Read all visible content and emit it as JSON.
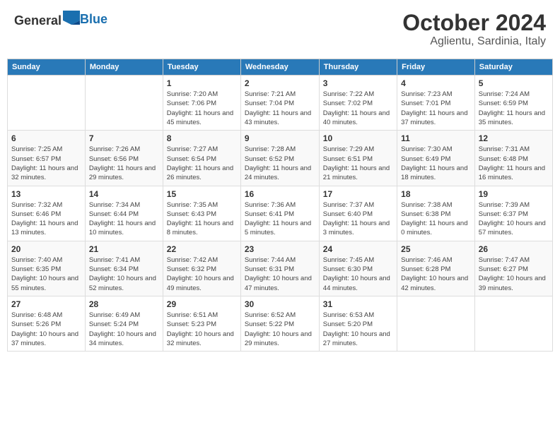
{
  "header": {
    "logo_general": "General",
    "logo_blue": "Blue",
    "month": "October 2024",
    "location": "Aglientu, Sardinia, Italy"
  },
  "weekdays": [
    "Sunday",
    "Monday",
    "Tuesday",
    "Wednesday",
    "Thursday",
    "Friday",
    "Saturday"
  ],
  "weeks": [
    [
      {
        "day": "",
        "info": ""
      },
      {
        "day": "",
        "info": ""
      },
      {
        "day": "1",
        "info": "Sunrise: 7:20 AM\nSunset: 7:06 PM\nDaylight: 11 hours and 45 minutes."
      },
      {
        "day": "2",
        "info": "Sunrise: 7:21 AM\nSunset: 7:04 PM\nDaylight: 11 hours and 43 minutes."
      },
      {
        "day": "3",
        "info": "Sunrise: 7:22 AM\nSunset: 7:02 PM\nDaylight: 11 hours and 40 minutes."
      },
      {
        "day": "4",
        "info": "Sunrise: 7:23 AM\nSunset: 7:01 PM\nDaylight: 11 hours and 37 minutes."
      },
      {
        "day": "5",
        "info": "Sunrise: 7:24 AM\nSunset: 6:59 PM\nDaylight: 11 hours and 35 minutes."
      }
    ],
    [
      {
        "day": "6",
        "info": "Sunrise: 7:25 AM\nSunset: 6:57 PM\nDaylight: 11 hours and 32 minutes."
      },
      {
        "day": "7",
        "info": "Sunrise: 7:26 AM\nSunset: 6:56 PM\nDaylight: 11 hours and 29 minutes."
      },
      {
        "day": "8",
        "info": "Sunrise: 7:27 AM\nSunset: 6:54 PM\nDaylight: 11 hours and 26 minutes."
      },
      {
        "day": "9",
        "info": "Sunrise: 7:28 AM\nSunset: 6:52 PM\nDaylight: 11 hours and 24 minutes."
      },
      {
        "day": "10",
        "info": "Sunrise: 7:29 AM\nSunset: 6:51 PM\nDaylight: 11 hours and 21 minutes."
      },
      {
        "day": "11",
        "info": "Sunrise: 7:30 AM\nSunset: 6:49 PM\nDaylight: 11 hours and 18 minutes."
      },
      {
        "day": "12",
        "info": "Sunrise: 7:31 AM\nSunset: 6:48 PM\nDaylight: 11 hours and 16 minutes."
      }
    ],
    [
      {
        "day": "13",
        "info": "Sunrise: 7:32 AM\nSunset: 6:46 PM\nDaylight: 11 hours and 13 minutes."
      },
      {
        "day": "14",
        "info": "Sunrise: 7:34 AM\nSunset: 6:44 PM\nDaylight: 11 hours and 10 minutes."
      },
      {
        "day": "15",
        "info": "Sunrise: 7:35 AM\nSunset: 6:43 PM\nDaylight: 11 hours and 8 minutes."
      },
      {
        "day": "16",
        "info": "Sunrise: 7:36 AM\nSunset: 6:41 PM\nDaylight: 11 hours and 5 minutes."
      },
      {
        "day": "17",
        "info": "Sunrise: 7:37 AM\nSunset: 6:40 PM\nDaylight: 11 hours and 3 minutes."
      },
      {
        "day": "18",
        "info": "Sunrise: 7:38 AM\nSunset: 6:38 PM\nDaylight: 11 hours and 0 minutes."
      },
      {
        "day": "19",
        "info": "Sunrise: 7:39 AM\nSunset: 6:37 PM\nDaylight: 10 hours and 57 minutes."
      }
    ],
    [
      {
        "day": "20",
        "info": "Sunrise: 7:40 AM\nSunset: 6:35 PM\nDaylight: 10 hours and 55 minutes."
      },
      {
        "day": "21",
        "info": "Sunrise: 7:41 AM\nSunset: 6:34 PM\nDaylight: 10 hours and 52 minutes."
      },
      {
        "day": "22",
        "info": "Sunrise: 7:42 AM\nSunset: 6:32 PM\nDaylight: 10 hours and 49 minutes."
      },
      {
        "day": "23",
        "info": "Sunrise: 7:44 AM\nSunset: 6:31 PM\nDaylight: 10 hours and 47 minutes."
      },
      {
        "day": "24",
        "info": "Sunrise: 7:45 AM\nSunset: 6:30 PM\nDaylight: 10 hours and 44 minutes."
      },
      {
        "day": "25",
        "info": "Sunrise: 7:46 AM\nSunset: 6:28 PM\nDaylight: 10 hours and 42 minutes."
      },
      {
        "day": "26",
        "info": "Sunrise: 7:47 AM\nSunset: 6:27 PM\nDaylight: 10 hours and 39 minutes."
      }
    ],
    [
      {
        "day": "27",
        "info": "Sunrise: 6:48 AM\nSunset: 5:26 PM\nDaylight: 10 hours and 37 minutes."
      },
      {
        "day": "28",
        "info": "Sunrise: 6:49 AM\nSunset: 5:24 PM\nDaylight: 10 hours and 34 minutes."
      },
      {
        "day": "29",
        "info": "Sunrise: 6:51 AM\nSunset: 5:23 PM\nDaylight: 10 hours and 32 minutes."
      },
      {
        "day": "30",
        "info": "Sunrise: 6:52 AM\nSunset: 5:22 PM\nDaylight: 10 hours and 29 minutes."
      },
      {
        "day": "31",
        "info": "Sunrise: 6:53 AM\nSunset: 5:20 PM\nDaylight: 10 hours and 27 minutes."
      },
      {
        "day": "",
        "info": ""
      },
      {
        "day": "",
        "info": ""
      }
    ]
  ]
}
